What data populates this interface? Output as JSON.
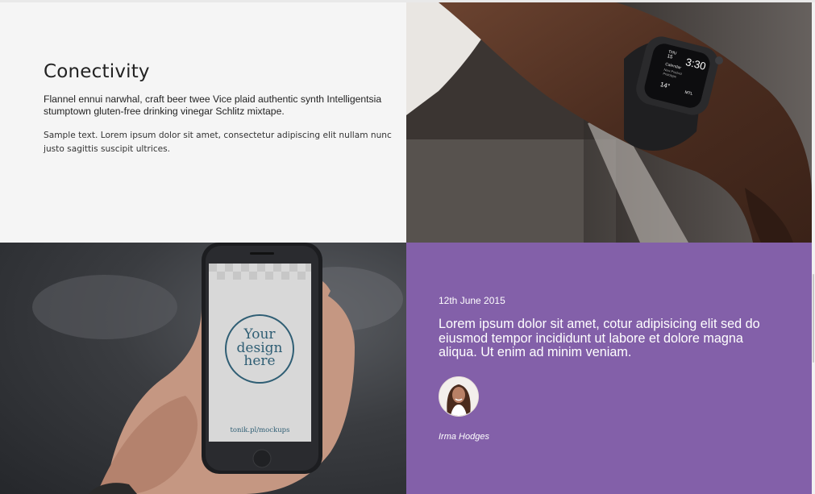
{
  "features": {
    "title": "Conectivity",
    "paragraph1": "Flannel ennui narwhal, craft beer twee Vice plaid authentic synth Intelligentsia stumptown gluten-free drinking vinegar Schlitz mixtape.",
    "paragraph2": "Sample text. Lorem ipsum dolor sit amet, consectetur adipiscing elit nullam nunc justo sagittis suscipit ultrices."
  },
  "watch": {
    "time": "3:30",
    "weekday": "THU",
    "day": "15",
    "event_label": "Calendar",
    "event_line1": "New Product",
    "event_line2": "Prototype",
    "temp": "14°",
    "activity": "MTL"
  },
  "phone": {
    "screen_line1": "Your",
    "screen_line2": "design",
    "screen_line3": "here",
    "screen_footer": "tonik.pl/mockups"
  },
  "testimonial": {
    "date": "12th June 2015",
    "quote": "Lorem ipsum dolor sit amet, cotur adipisicing elit sed do eiusmod tempor incididunt ut labore et dolore magna aliqua. Ut enim ad minim veniam.",
    "author": "Irma Hodges"
  },
  "colors": {
    "accent_purple": "#8360a9",
    "panel_gray": "#f5f5f5",
    "phone_screen_text": "#2f5e74"
  }
}
